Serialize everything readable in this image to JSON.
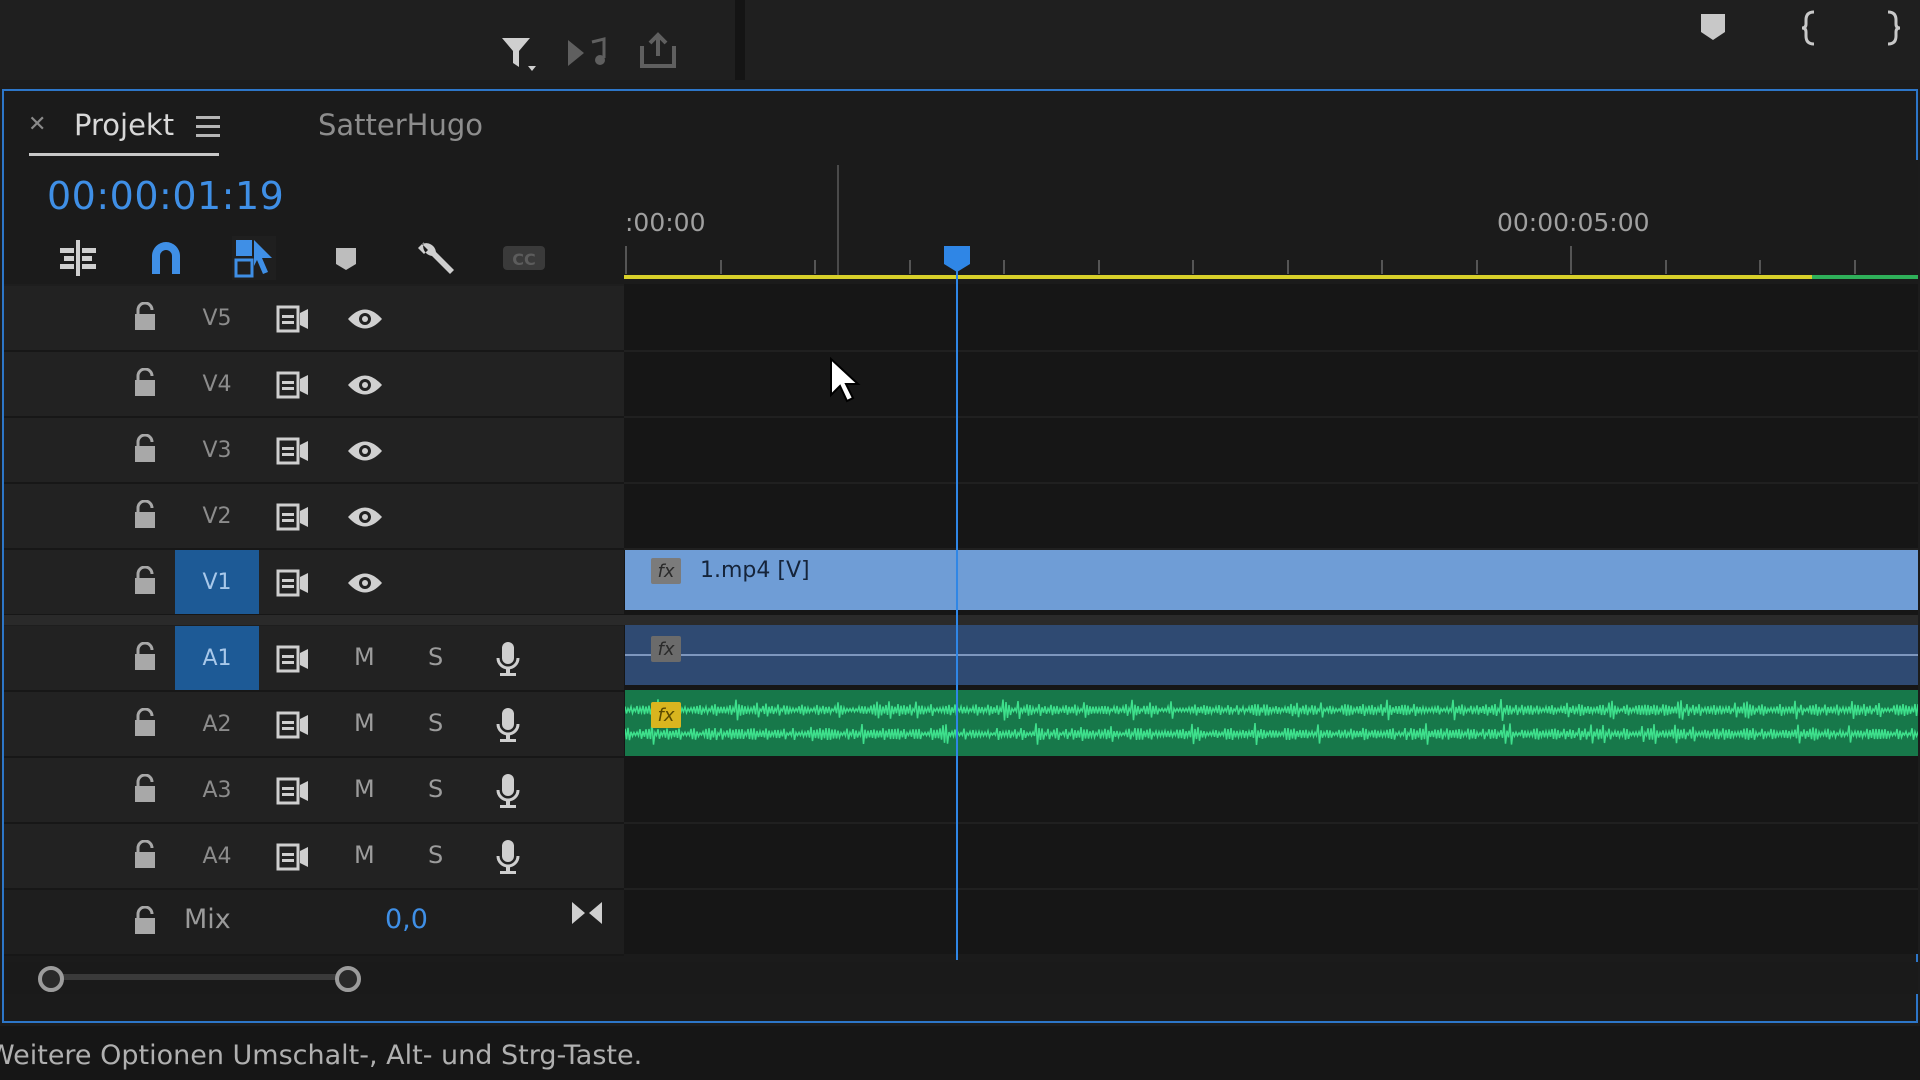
{
  "window": {
    "tabs": [
      {
        "label": "Projekt",
        "active": true,
        "closable": true
      },
      {
        "label": "SatterHugo",
        "active": false
      }
    ],
    "timecode": "00:00:01:19"
  },
  "toolbar": {
    "tools": [
      {
        "name": "insert-nested-icon",
        "selected": false
      },
      {
        "name": "snap-magnet-icon",
        "selected": false
      },
      {
        "name": "linked-selection-icon",
        "selected": true
      },
      {
        "name": "add-marker-icon",
        "selected": false
      },
      {
        "name": "wrench-settings-icon",
        "selected": false
      },
      {
        "name": "captions-cc-icon",
        "selected": false
      }
    ],
    "cc_label": "CC"
  },
  "top_icons": {
    "left": [
      "filter-icon",
      "insert-audio-icon",
      "export-icon"
    ],
    "right": [
      "marker-icon",
      "mark-in-icon",
      "mark-out-icon"
    ]
  },
  "ruler": {
    "labels": [
      ":00:00",
      "00:00:05:00"
    ]
  },
  "video_tracks": [
    {
      "name": "V5",
      "active": false
    },
    {
      "name": "V4",
      "active": false
    },
    {
      "name": "V3",
      "active": false
    },
    {
      "name": "V2",
      "active": false
    },
    {
      "name": "V1",
      "active": true
    }
  ],
  "audio_tracks": [
    {
      "name": "A1",
      "active": true
    },
    {
      "name": "A2",
      "active": false
    },
    {
      "name": "A3",
      "active": false
    },
    {
      "name": "A4",
      "active": false
    }
  ],
  "audio_buttons": {
    "mute": "M",
    "solo": "S"
  },
  "clips": {
    "v1_label": "1.mp4 [V]",
    "fx_label": "fx"
  },
  "mix": {
    "label": "Mix",
    "value": "0,0"
  },
  "status_bar": {
    "text": "Weitere Optionen Umschalt-, Alt- und Strg-Taste."
  },
  "colors": {
    "accent": "#2d76c8",
    "timecode": "#3f8fe6",
    "video_clip": "#6f9dd6",
    "audio_clip_a1": "#2f4a72",
    "audio_clip_a2": "#17784a",
    "waveform": "#3ee08c",
    "work_area": "#d8d02a",
    "render_ok": "#2fb05a"
  }
}
